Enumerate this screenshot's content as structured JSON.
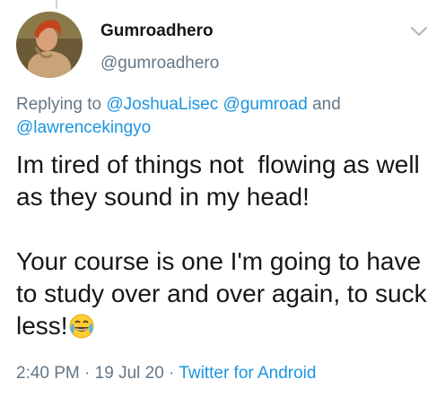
{
  "tweet": {
    "display_name": "Gumroadhero",
    "handle": "@gumroadhero",
    "reply_prefix": "Replying to",
    "mentions": [
      "@JoshuaLisec",
      "@gumroad",
      "@lawrencekingyo"
    ],
    "reply_conjunction": "and",
    "text_line1": "Im tired of things not  flowing as well as they sound in my head!",
    "text_line2": "Your course is one I'm going to have to study over and over again, to suck less!",
    "emoji": "face-with-tears-of-joy",
    "time": "2:40 PM",
    "date": "19 Jul 20",
    "separator": "·",
    "source": "Twitter for Android"
  },
  "colors": {
    "text": "#14171a",
    "secondary": "#657786",
    "link": "#1b95e0"
  }
}
